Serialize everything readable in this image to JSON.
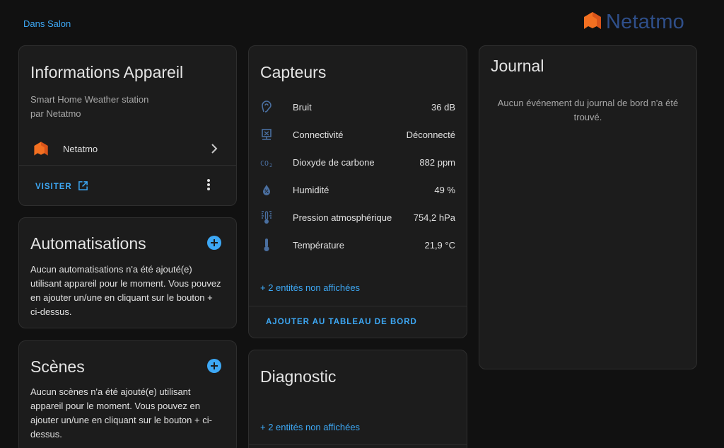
{
  "header": {
    "area_link": "Dans Salon",
    "brand_name": "Netatmo",
    "brand_color": "#f37021"
  },
  "device_info": {
    "title": "Informations Appareil",
    "model": "Smart Home Weather station",
    "manufacturer": "par Netatmo",
    "integration": "Netatmo",
    "visit_label": "VISITER"
  },
  "automations": {
    "title": "Automatisations",
    "empty_text": "Aucun automatisations n'a été ajouté(e) utilisant appareil pour le moment. Vous pouvez en ajouter un/une en cliquant sur le bouton + ci-dessus."
  },
  "scenes": {
    "title": "Scènes",
    "empty_text": "Aucun scènes n'a été ajouté(e) utilisant appareil pour le moment. Vous pouvez en ajouter un/une en cliquant sur le bouton + ci-dessus."
  },
  "sensors": {
    "title": "Capteurs",
    "rows": [
      {
        "icon": "ear-icon",
        "label": "Bruit",
        "value": "36 dB"
      },
      {
        "icon": "network-off-icon",
        "label": "Connectivité",
        "value": "Déconnecté"
      },
      {
        "icon": "co2-icon",
        "label": "Dioxyde de carbone",
        "value": "882 ppm"
      },
      {
        "icon": "water-percent-icon",
        "label": "Humidité",
        "value": "49 %"
      },
      {
        "icon": "gauge-icon",
        "label": "Pression atmosphérique",
        "value": "754,2 hPa"
      },
      {
        "icon": "thermometer-icon",
        "label": "Température",
        "value": "21,9 °C"
      }
    ],
    "hidden_entities": "+ 2 entités non affichées",
    "add_to_dashboard": "AJOUTER AU TABLEAU DE BORD"
  },
  "diagnostic": {
    "title": "Diagnostic",
    "hidden_entities": "+ 2 entités non affichées"
  },
  "logbook": {
    "title": "Journal",
    "empty_text": "Aucun événement du journal de bord n'a été trouvé."
  },
  "colors": {
    "accent": "#3da8f5",
    "card_bg": "#1c1c1c",
    "page_bg": "#111111",
    "icon": "#4a6fa0"
  }
}
